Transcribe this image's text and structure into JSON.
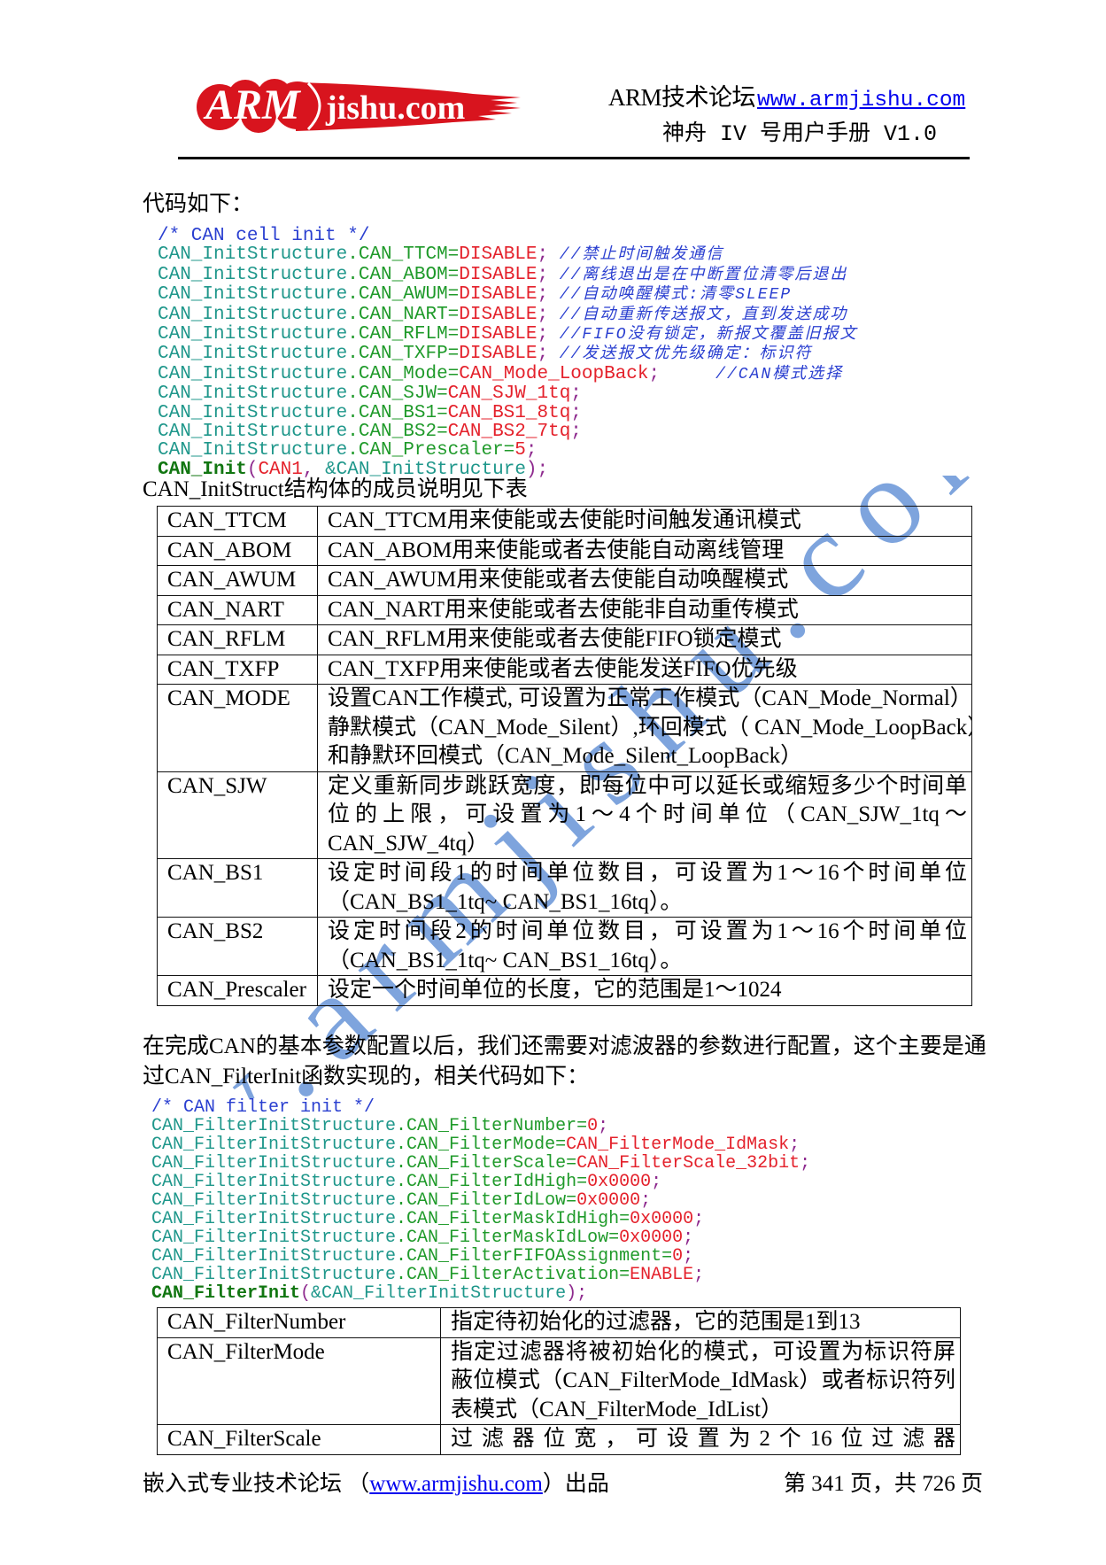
{
  "header": {
    "logo": {
      "primary": "ARM",
      "secondary": "jishu.com"
    },
    "forum_label": "ARM技术论坛",
    "site_link": "www.armjishu.com",
    "manual_title": "神舟 IV 号用户手册 V1.0"
  },
  "intro": "代码如下：",
  "code_block_1": [
    [
      {
        "t": "/* CAN cell init */",
        "k": "block_comment"
      }
    ],
    [
      {
        "t": "CAN_InitStructure",
        "k": "struct"
      },
      {
        "t": ".CAN_TTCM=",
        "k": "member"
      },
      {
        "t": "DISABLE",
        "k": "value"
      },
      {
        "t": ";",
        "k": "punct"
      },
      {
        "t": " ",
        "k": "space"
      },
      {
        "t": "//禁止时间触发通信",
        "k": "line_comment"
      }
    ],
    [
      {
        "t": "CAN_InitStructure",
        "k": "struct"
      },
      {
        "t": ".CAN_ABOM=",
        "k": "member"
      },
      {
        "t": "DISABLE",
        "k": "value"
      },
      {
        "t": ";",
        "k": "punct"
      },
      {
        "t": " ",
        "k": "space"
      },
      {
        "t": "//离线退出是在中断置位清零后退出",
        "k": "line_comment"
      }
    ],
    [
      {
        "t": "CAN_InitStructure",
        "k": "struct"
      },
      {
        "t": ".CAN_AWUM=",
        "k": "member"
      },
      {
        "t": "DISABLE",
        "k": "value"
      },
      {
        "t": ";",
        "k": "punct"
      },
      {
        "t": " ",
        "k": "space"
      },
      {
        "t": "//自动唤醒模式:清零SLEEP",
        "k": "line_comment"
      }
    ],
    [
      {
        "t": "CAN_InitStructure",
        "k": "struct"
      },
      {
        "t": ".CAN_NART=",
        "k": "member"
      },
      {
        "t": "DISABLE",
        "k": "value"
      },
      {
        "t": ";",
        "k": "punct"
      },
      {
        "t": " ",
        "k": "space"
      },
      {
        "t": "//自动重新传送报文，直到发送成功",
        "k": "line_comment"
      }
    ],
    [
      {
        "t": "CAN_InitStructure",
        "k": "struct"
      },
      {
        "t": ".CAN_RFLM=",
        "k": "member"
      },
      {
        "t": "DISABLE",
        "k": "value"
      },
      {
        "t": ";",
        "k": "punct"
      },
      {
        "t": " ",
        "k": "space"
      },
      {
        "t": "//FIFO没有锁定，新报文覆盖旧报文",
        "k": "line_comment"
      }
    ],
    [
      {
        "t": "CAN_InitStructure",
        "k": "struct"
      },
      {
        "t": ".CAN_TXFP=",
        "k": "member"
      },
      {
        "t": "DISABLE",
        "k": "value"
      },
      {
        "t": ";",
        "k": "punct"
      },
      {
        "t": " ",
        "k": "space"
      },
      {
        "t": "//发送报文优先级确定：标识符",
        "k": "line_comment"
      }
    ],
    [
      {
        "t": "CAN_InitStructure",
        "k": "struct"
      },
      {
        "t": ".CAN_Mode=",
        "k": "member"
      },
      {
        "t": "CAN_Mode_LoopBack",
        "k": "value"
      },
      {
        "t": ";",
        "k": "punct"
      },
      {
        "t": "     ",
        "k": "space"
      },
      {
        "t": "//CAN模式选择",
        "k": "line_comment"
      }
    ],
    [
      {
        "t": "CAN_InitStructure",
        "k": "struct"
      },
      {
        "t": ".CAN_SJW=",
        "k": "member"
      },
      {
        "t": "CAN_SJW_1tq",
        "k": "value"
      },
      {
        "t": ";",
        "k": "punct"
      }
    ],
    [
      {
        "t": "CAN_InitStructure",
        "k": "struct"
      },
      {
        "t": ".CAN_BS1=",
        "k": "member"
      },
      {
        "t": "CAN_BS1_8tq",
        "k": "value"
      },
      {
        "t": ";",
        "k": "punct"
      }
    ],
    [
      {
        "t": "CAN_InitStructure",
        "k": "struct"
      },
      {
        "t": ".CAN_BS2=",
        "k": "member"
      },
      {
        "t": "CAN_BS2_7tq",
        "k": "value"
      },
      {
        "t": ";",
        "k": "punct"
      }
    ],
    [
      {
        "t": "CAN_InitStructure",
        "k": "struct"
      },
      {
        "t": ".CAN_Prescaler=",
        "k": "member"
      },
      {
        "t": "5",
        "k": "value"
      },
      {
        "t": ";",
        "k": "punct"
      }
    ],
    [
      {
        "t": "CAN_Init",
        "k": "func"
      },
      {
        "t": "(",
        "k": "punct"
      },
      {
        "t": "CAN1",
        "k": "value"
      },
      {
        "t": ", ",
        "k": "punct"
      },
      {
        "t": "&CAN_InitStructure",
        "k": "struct"
      },
      {
        "t": ");",
        "k": "punct"
      }
    ]
  ],
  "table_1_caption": "CAN_InitStruct结构体的成员说明见下表",
  "table_1": [
    {
      "name": "CAN_TTCM",
      "desc": [
        "CAN_TTCM用来使能或去使能时间触发通讯模式"
      ]
    },
    {
      "name": "CAN_ABOM",
      "desc": [
        "CAN_ABOM用来使能或者去使能自动离线管理"
      ]
    },
    {
      "name": "CAN_AWUM",
      "desc": [
        "CAN_AWUM用来使能或者去使能自动唤醒模式"
      ]
    },
    {
      "name": "CAN_NART",
      "desc": [
        "CAN_NART用来使能或者去使能非自动重传模式"
      ]
    },
    {
      "name": "CAN_RFLM",
      "desc": [
        "CAN_RFLM用来使能或者去使能FIFO锁定模式"
      ]
    },
    {
      "name": "CAN_TXFP",
      "desc": [
        "CAN_TXFP用来使能或者去使能发送FIFO优先级"
      ]
    },
    {
      "name": "CAN_MODE",
      "desc": [
        "设置CAN工作模式, 可设置为正常工作模式（CAN_Mode_Normal）",
        "静默模式（CAN_Mode_Silent）,环回模式（ CAN_Mode_LoopBack）",
        "和静默环回模式（CAN_Mode_Silent_LoopBack）"
      ]
    },
    {
      "name": "CAN_SJW",
      "desc": [
        "定义重新同步跳跃宽度，即每位中可以延长或缩短多少个时间单",
        "位的上限，可设置为1～4个时间单位（CAN_SJW_1tq～",
        "CAN_SJW_4tq）"
      ]
    },
    {
      "name": "CAN_BS1",
      "desc": [
        "设定时间段1的时间单位数目，可设置为1～16个时间单位",
        "（CAN_BS1_1tq~ CAN_BS1_16tq）。"
      ]
    },
    {
      "name": "CAN_BS2",
      "desc": [
        "设定时间段2的时间单位数目，可设置为1～16个时间单位",
        "（CAN_BS1_1tq~ CAN_BS1_16tq）。"
      ]
    },
    {
      "name": "CAN_Prescaler",
      "desc": [
        "设定一个时间单位的长度，它的范围是1～1024"
      ]
    }
  ],
  "paragraph": [
    "在完成CAN的基本参数配置以后，我们还需要对滤波器的参数进行配置，这个主要是通",
    "过CAN_FilterInit函数实现的，相关代码如下："
  ],
  "code_block_2": [
    [
      {
        "t": "/* CAN filter init */",
        "k": "block_comment"
      }
    ],
    [
      {
        "t": "CAN_FilterInitStructure",
        "k": "struct"
      },
      {
        "t": ".CAN_FilterNumber=",
        "k": "member"
      },
      {
        "t": "0",
        "k": "value"
      },
      {
        "t": ";",
        "k": "punct"
      }
    ],
    [
      {
        "t": "CAN_FilterInitStructure",
        "k": "struct"
      },
      {
        "t": ".CAN_FilterMode=",
        "k": "member"
      },
      {
        "t": "CAN_FilterMode_IdMask",
        "k": "value"
      },
      {
        "t": ";",
        "k": "punct"
      }
    ],
    [
      {
        "t": "CAN_FilterInitStructure",
        "k": "struct"
      },
      {
        "t": ".CAN_FilterScale=",
        "k": "member"
      },
      {
        "t": "CAN_FilterScale_32bit",
        "k": "value"
      },
      {
        "t": ";",
        "k": "punct"
      }
    ],
    [
      {
        "t": "CAN_FilterInitStructure",
        "k": "struct"
      },
      {
        "t": ".CAN_FilterIdHigh=",
        "k": "member"
      },
      {
        "t": "0x0000",
        "k": "value"
      },
      {
        "t": ";",
        "k": "punct"
      }
    ],
    [
      {
        "t": "CAN_FilterInitStructure",
        "k": "struct"
      },
      {
        "t": ".CAN_FilterIdLow=",
        "k": "member"
      },
      {
        "t": "0x0000",
        "k": "value"
      },
      {
        "t": ";",
        "k": "punct"
      }
    ],
    [
      {
        "t": "CAN_FilterInitStructure",
        "k": "struct"
      },
      {
        "t": ".CAN_FilterMaskIdHigh=",
        "k": "member"
      },
      {
        "t": "0x0000",
        "k": "value"
      },
      {
        "t": ";",
        "k": "punct"
      }
    ],
    [
      {
        "t": "CAN_FilterInitStructure",
        "k": "struct"
      },
      {
        "t": ".CAN_FilterMaskIdLow=",
        "k": "member"
      },
      {
        "t": "0x0000",
        "k": "value"
      },
      {
        "t": ";",
        "k": "punct"
      }
    ],
    [
      {
        "t": "CAN_FilterInitStructure",
        "k": "struct"
      },
      {
        "t": ".CAN_FilterFIFOAssignment=",
        "k": "member"
      },
      {
        "t": "0",
        "k": "value"
      },
      {
        "t": ";",
        "k": "punct"
      }
    ],
    [
      {
        "t": "CAN_FilterInitStructure",
        "k": "struct"
      },
      {
        "t": ".CAN_FilterActivation=",
        "k": "member"
      },
      {
        "t": "ENABLE",
        "k": "value"
      },
      {
        "t": ";",
        "k": "punct"
      }
    ],
    [
      {
        "t": "CAN_FilterInit",
        "k": "func"
      },
      {
        "t": "(",
        "k": "punct"
      },
      {
        "t": "&CAN_FilterInitStructure",
        "k": "struct"
      },
      {
        "t": ");",
        "k": "punct"
      }
    ]
  ],
  "table_2": [
    {
      "name": "CAN_FilterNumber",
      "desc": [
        "指定待初始化的过滤器，它的范围是1到13"
      ]
    },
    {
      "name": "CAN_FilterMode",
      "desc": [
        "指定过滤器将被初始化的模式，可设置为标识符屏",
        "蔽位模式（CAN_FilterMode_IdMask）或者标识符列",
        "表模式（CAN_FilterMode_IdList）"
      ]
    },
    {
      "name": "CAN_FilterScale",
      "desc": [
        "过滤器位宽，可设置为2个16位过滤器"
      ]
    }
  ],
  "footer": {
    "left_prefix": "嵌入式专业技术论坛 （",
    "site_link": "www.armjishu.com",
    "left_suffix": "）出品",
    "page_info": "第 341 页，共 726 页"
  },
  "watermark": {
    "text": "www.armjishu.com"
  },
  "colors": {
    "comment": "#2a3fd0",
    "struct": "#1f978b",
    "member": "#1f9a2a",
    "value": "#e4212b",
    "punct": "#8e2a8e",
    "func": "#117611",
    "link": "#0000ee",
    "logo_red": "#d8141e",
    "watermark": "#7ea4dd"
  }
}
